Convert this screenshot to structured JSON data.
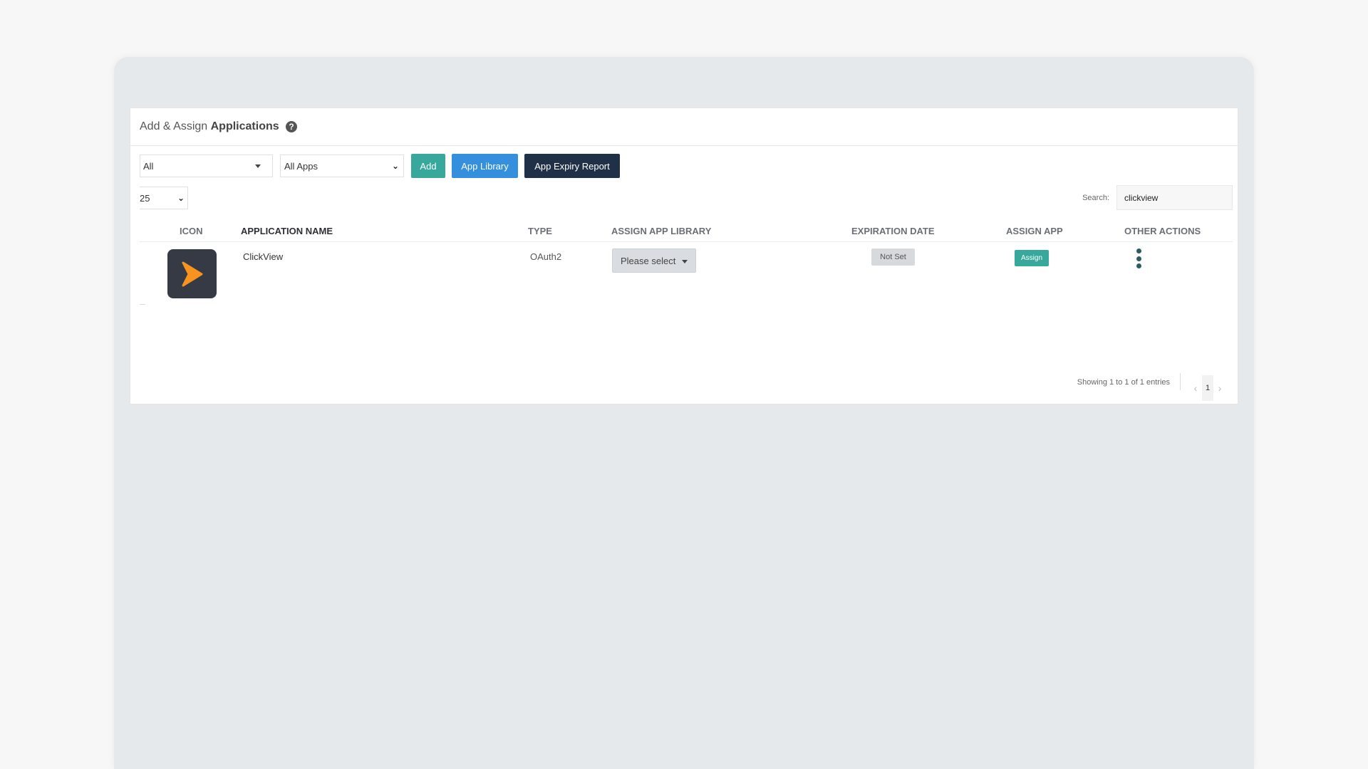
{
  "header": {
    "title_light": "Add & Assign",
    "title_bold": "Applications",
    "help_glyph": "?"
  },
  "toolbar": {
    "filter_all_value": "All",
    "filter_apps_value": "All Apps",
    "add_label": "Add",
    "app_library_label": "App Library",
    "app_expiry_report_label": "App Expiry Report"
  },
  "table_controls": {
    "page_length_value": "25",
    "search_label": "Search:",
    "search_value": "clickview"
  },
  "table": {
    "columns": {
      "icon": "ICON",
      "application_name": "APPLICATION NAME",
      "type": "TYPE",
      "assign_app_library": "ASSIGN APP LIBRARY",
      "expiration_date": "EXPIRATION DATE",
      "assign_app": "ASSIGN APP",
      "other_actions": "OTHER ACTIONS"
    },
    "rows": [
      {
        "icon": "clickview-play-icon",
        "name": "ClickView",
        "type": "OAuth2",
        "library_select": "Please select",
        "expiration": "Not Set",
        "assign_label": "Assign"
      }
    ]
  },
  "footer": {
    "info": "Showing 1 to 1 of 1 entries",
    "current_page": "1",
    "prev_glyph": "‹",
    "next_glyph": "›"
  },
  "colors": {
    "teal": "#38a89d",
    "blue": "#3490dc",
    "navy": "#1f3047",
    "icon_bg": "#353a45",
    "icon_orange": "#f7931e"
  }
}
